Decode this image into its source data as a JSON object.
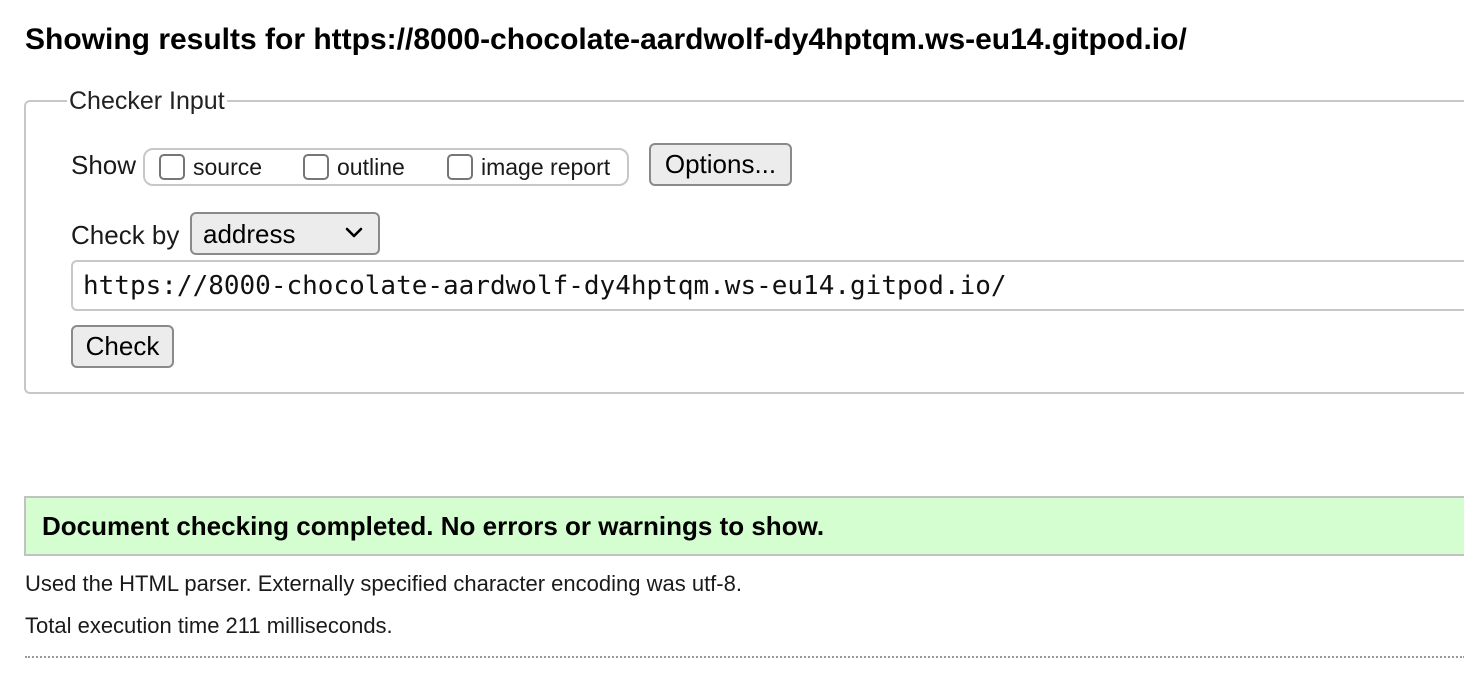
{
  "heading": "Showing results for https://8000-chocolate-aardwolf-dy4hptqm.ws-eu14.gitpod.io/",
  "checker_input": {
    "legend": "Checker Input",
    "show_label": "Show",
    "show_options": [
      {
        "label": "source",
        "checked": false
      },
      {
        "label": "outline",
        "checked": false
      },
      {
        "label": "image report",
        "checked": false
      }
    ],
    "options_button": "Options...",
    "check_by_label": "Check by",
    "check_by_value": "address",
    "url_value": "https://8000-chocolate-aardwolf-dy4hptqm.ws-eu14.gitpod.io/",
    "check_button": "Check"
  },
  "result": {
    "message": "Document checking completed. No errors or warnings to show.",
    "background_color": "#d4fdd0"
  },
  "info": {
    "parser": "Used the HTML parser. Externally specified character encoding was utf-8.",
    "time": "Total execution time 211 milliseconds."
  }
}
